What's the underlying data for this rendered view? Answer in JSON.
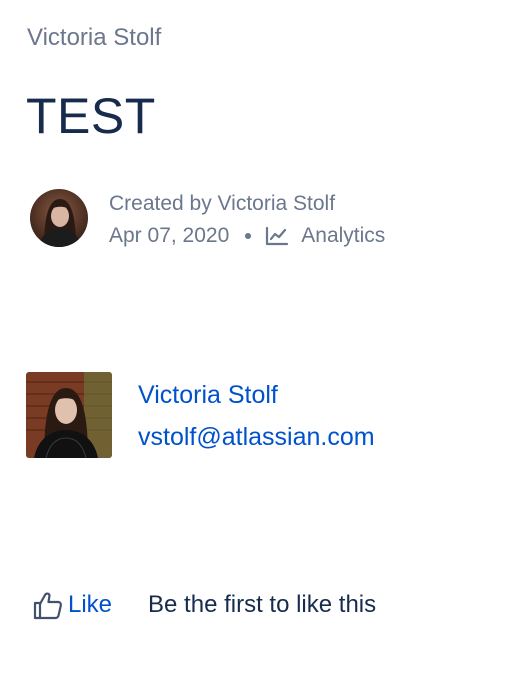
{
  "breadcrumb": {
    "space_name": "Victoria Stolf"
  },
  "page": {
    "title": "TEST"
  },
  "byline": {
    "created_by": "Created by Victoria Stolf",
    "date": "Apr 07, 2020",
    "analytics_label": "Analytics"
  },
  "profile": {
    "name": "Victoria Stolf",
    "email": "vstolf@atlassian.com"
  },
  "likes": {
    "like_label": "Like",
    "summary": "Be the first to like this"
  },
  "colors": {
    "link": "#0052CC",
    "text": "#172B4D",
    "subtle": "#6B778C"
  },
  "icons": {
    "analytics": "analytics-chart-icon",
    "like": "thumbs-up-icon"
  }
}
